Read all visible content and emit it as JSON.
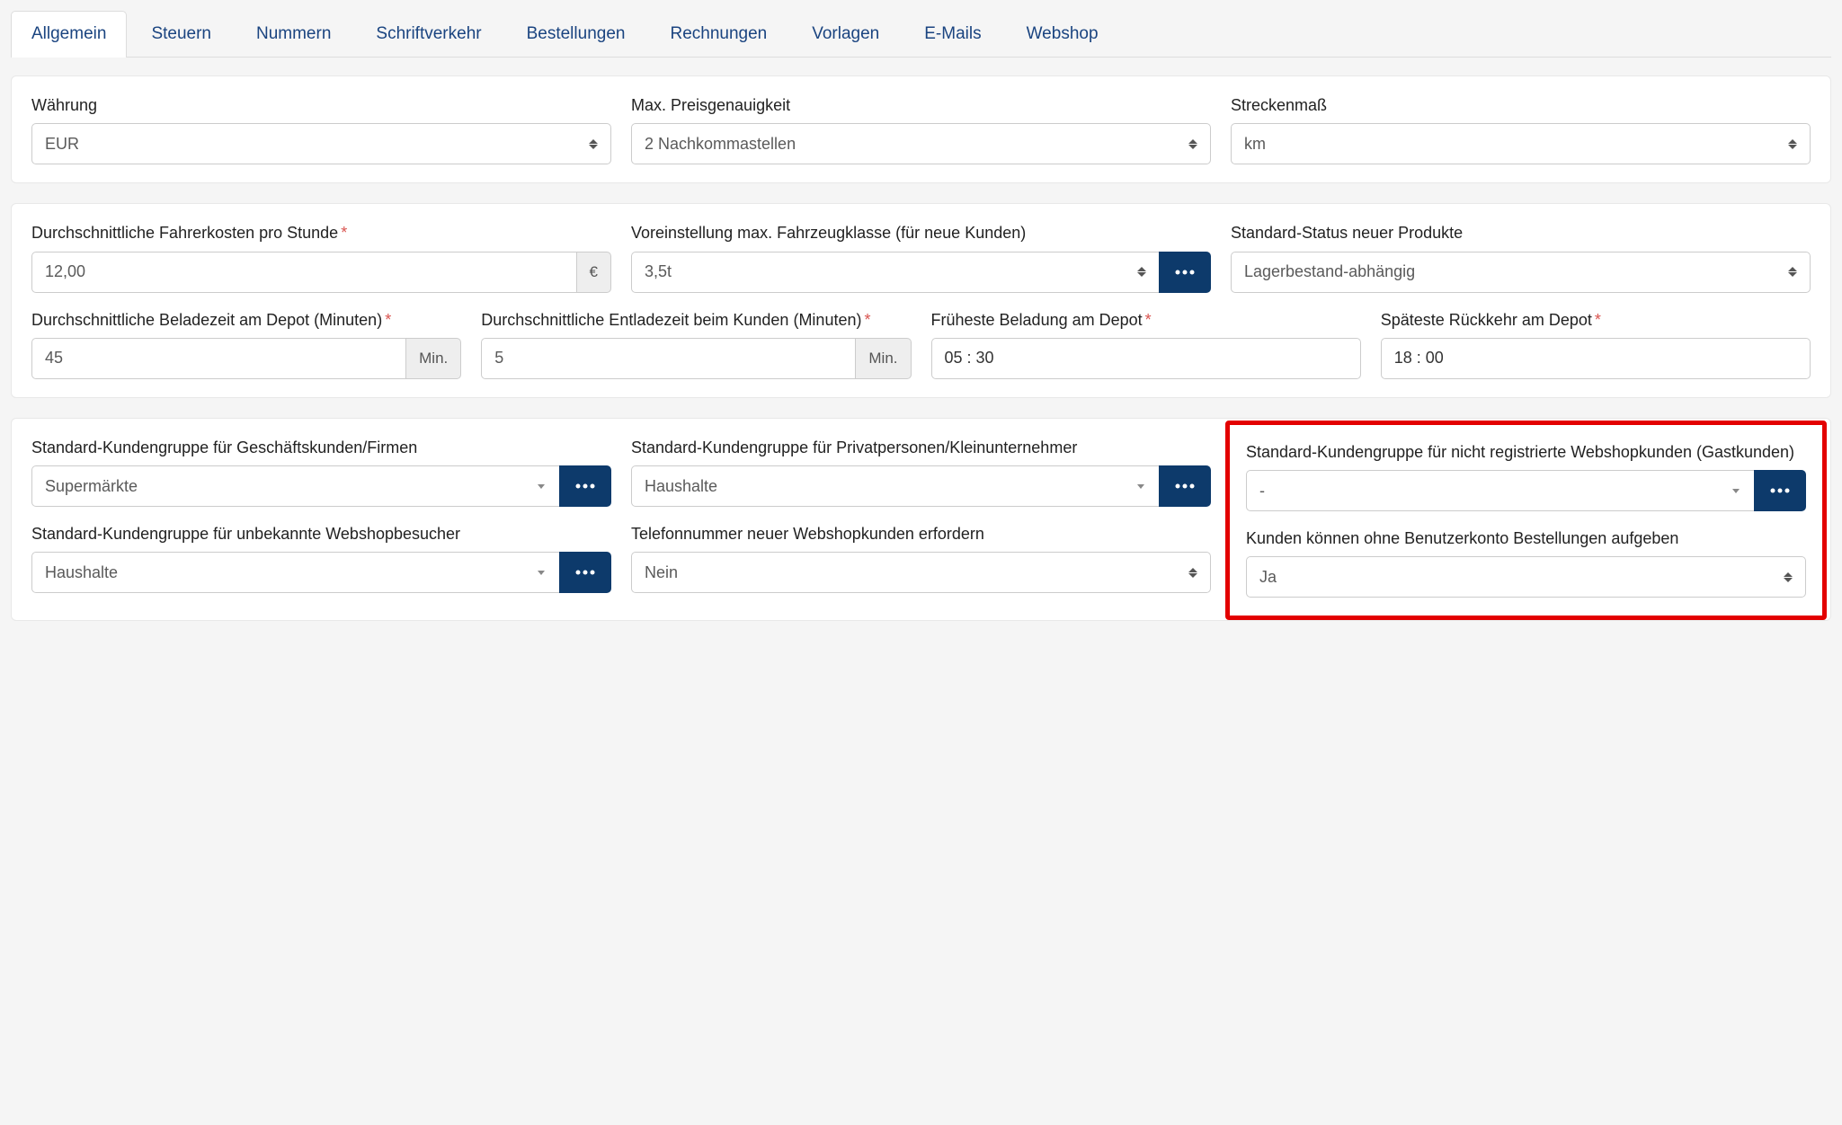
{
  "tabs": [
    {
      "label": "Allgemein",
      "active": true
    },
    {
      "label": "Steuern"
    },
    {
      "label": "Nummern"
    },
    {
      "label": "Schriftverkehr"
    },
    {
      "label": "Bestellungen"
    },
    {
      "label": "Rechnungen"
    },
    {
      "label": "Vorlagen"
    },
    {
      "label": "E-Mails"
    },
    {
      "label": "Webshop"
    }
  ],
  "panel1": {
    "currency": {
      "label": "Währung",
      "value": "EUR"
    },
    "precision": {
      "label": "Max. Preisgenauigkeit",
      "value": "2 Nachkommastellen"
    },
    "distance": {
      "label": "Streckenmaß",
      "value": "km"
    }
  },
  "panel2": {
    "driverCost": {
      "label": "Durchschnittliche Fahrerkosten pro Stunde",
      "value": "12,00",
      "unit": "€"
    },
    "vehicleClass": {
      "label": "Voreinstellung max. Fahrzeugklasse (für neue Kunden)",
      "value": "3,5t"
    },
    "productStatus": {
      "label": "Standard-Status neuer Produkte",
      "value": "Lagerbestand-abhängig"
    },
    "loadTime": {
      "label": "Durchschnittliche Beladezeit am Depot (Minuten)",
      "value": "45",
      "unit": "Min."
    },
    "unloadTime": {
      "label": "Durchschnittliche Entladezeit beim Kunden (Minuten)",
      "value": "5",
      "unit": "Min."
    },
    "earliestLoad": {
      "label": "Früheste Beladung am Depot",
      "value": "05 : 30"
    },
    "latestReturn": {
      "label": "Späteste Rückkehr am Depot",
      "value": "18 : 00"
    }
  },
  "panel3": {
    "groupBusiness": {
      "label": "Standard-Kundengruppe für Geschäftskunden/Firmen",
      "value": "Supermärkte"
    },
    "groupPrivate": {
      "label": "Standard-Kundengruppe für Privatpersonen/Kleinunternehmer",
      "value": "Haushalte"
    },
    "groupGuest": {
      "label": "Standard-Kundengruppe für nicht registrierte Webshopkunden (Gastkunden)",
      "value": "-"
    },
    "groupUnknown": {
      "label": "Standard-Kundengruppe für unbekannte Webshopbesucher",
      "value": "Haushalte"
    },
    "phoneRequired": {
      "label": "Telefonnummer neuer Webshopkunden erfordern",
      "value": "Nein"
    },
    "guestOrder": {
      "label": "Kunden können ohne Benutzerkonto Bestellungen aufgeben",
      "value": "Ja"
    }
  }
}
